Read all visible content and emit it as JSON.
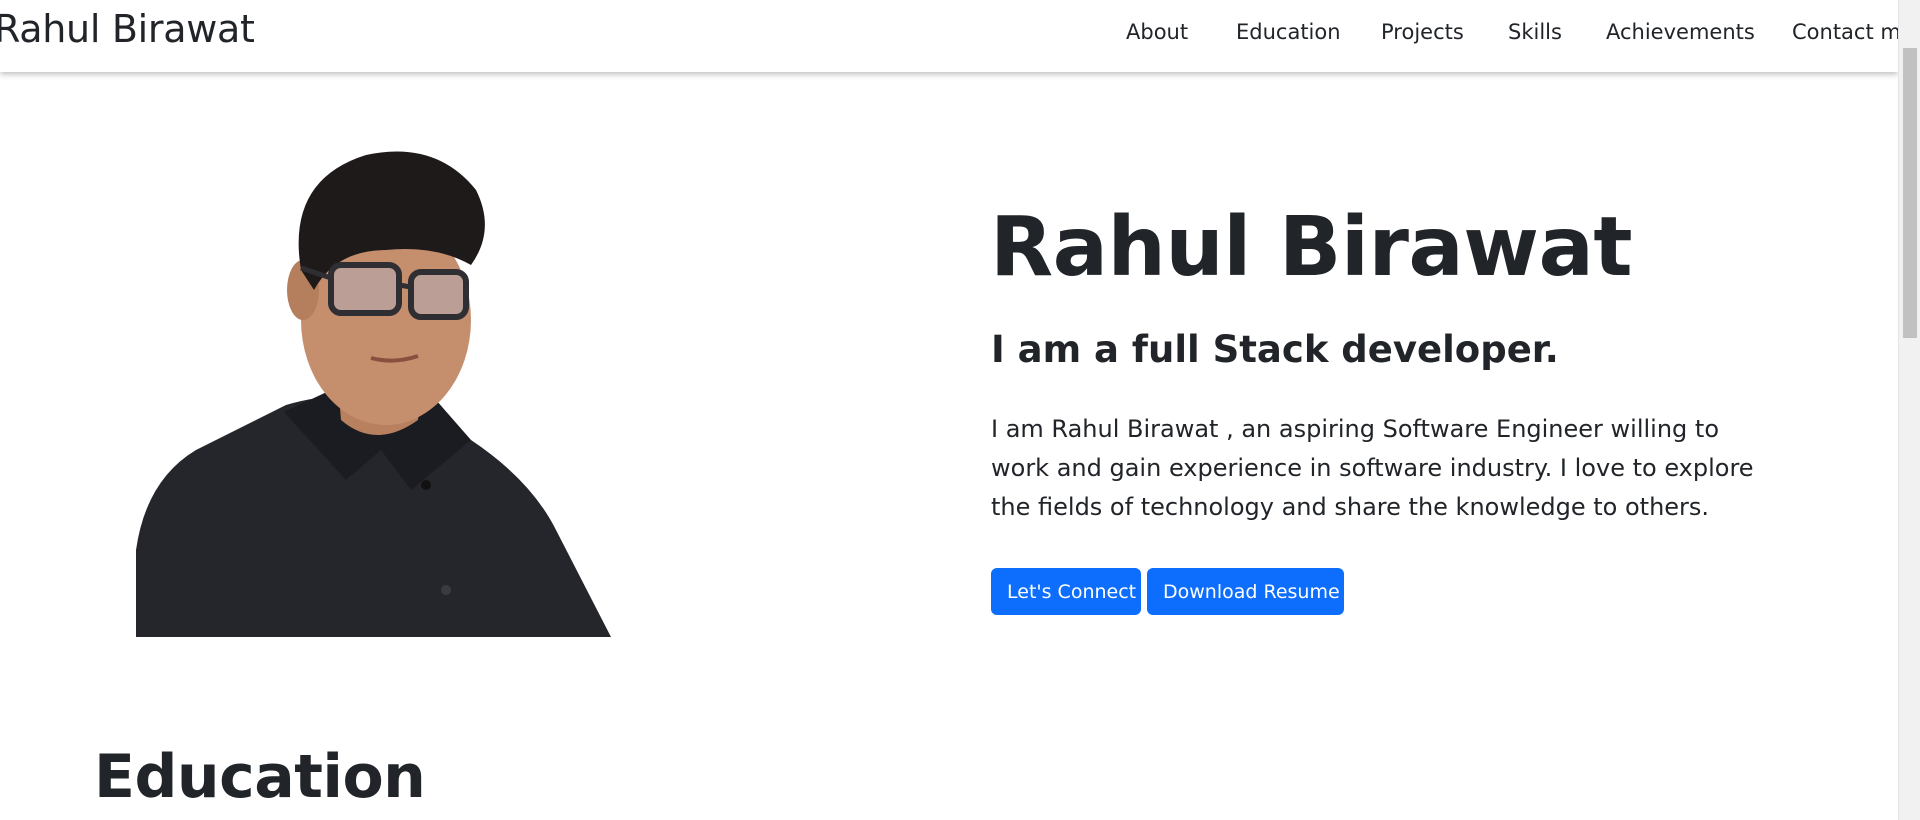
{
  "navbar": {
    "brand": "Rahul Birawat",
    "links": [
      "About",
      "Education",
      "Projects",
      "Skills",
      "Achievements",
      "Contact me"
    ]
  },
  "hero": {
    "title": "Rahul Birawat",
    "subtitle": "I am a full Stack developer.",
    "description": "I am Rahul Birawat , an aspiring Software Engineer willing to work and gain experience in software industry. I love to explore the fields of technology and share the knowledge to others.",
    "connect_label": "Let's Connect",
    "resume_label": "Download Resume"
  },
  "education": {
    "title": "Education"
  },
  "colors": {
    "primary": "#0d6efd",
    "text": "#212529",
    "background": "#ffffff"
  }
}
